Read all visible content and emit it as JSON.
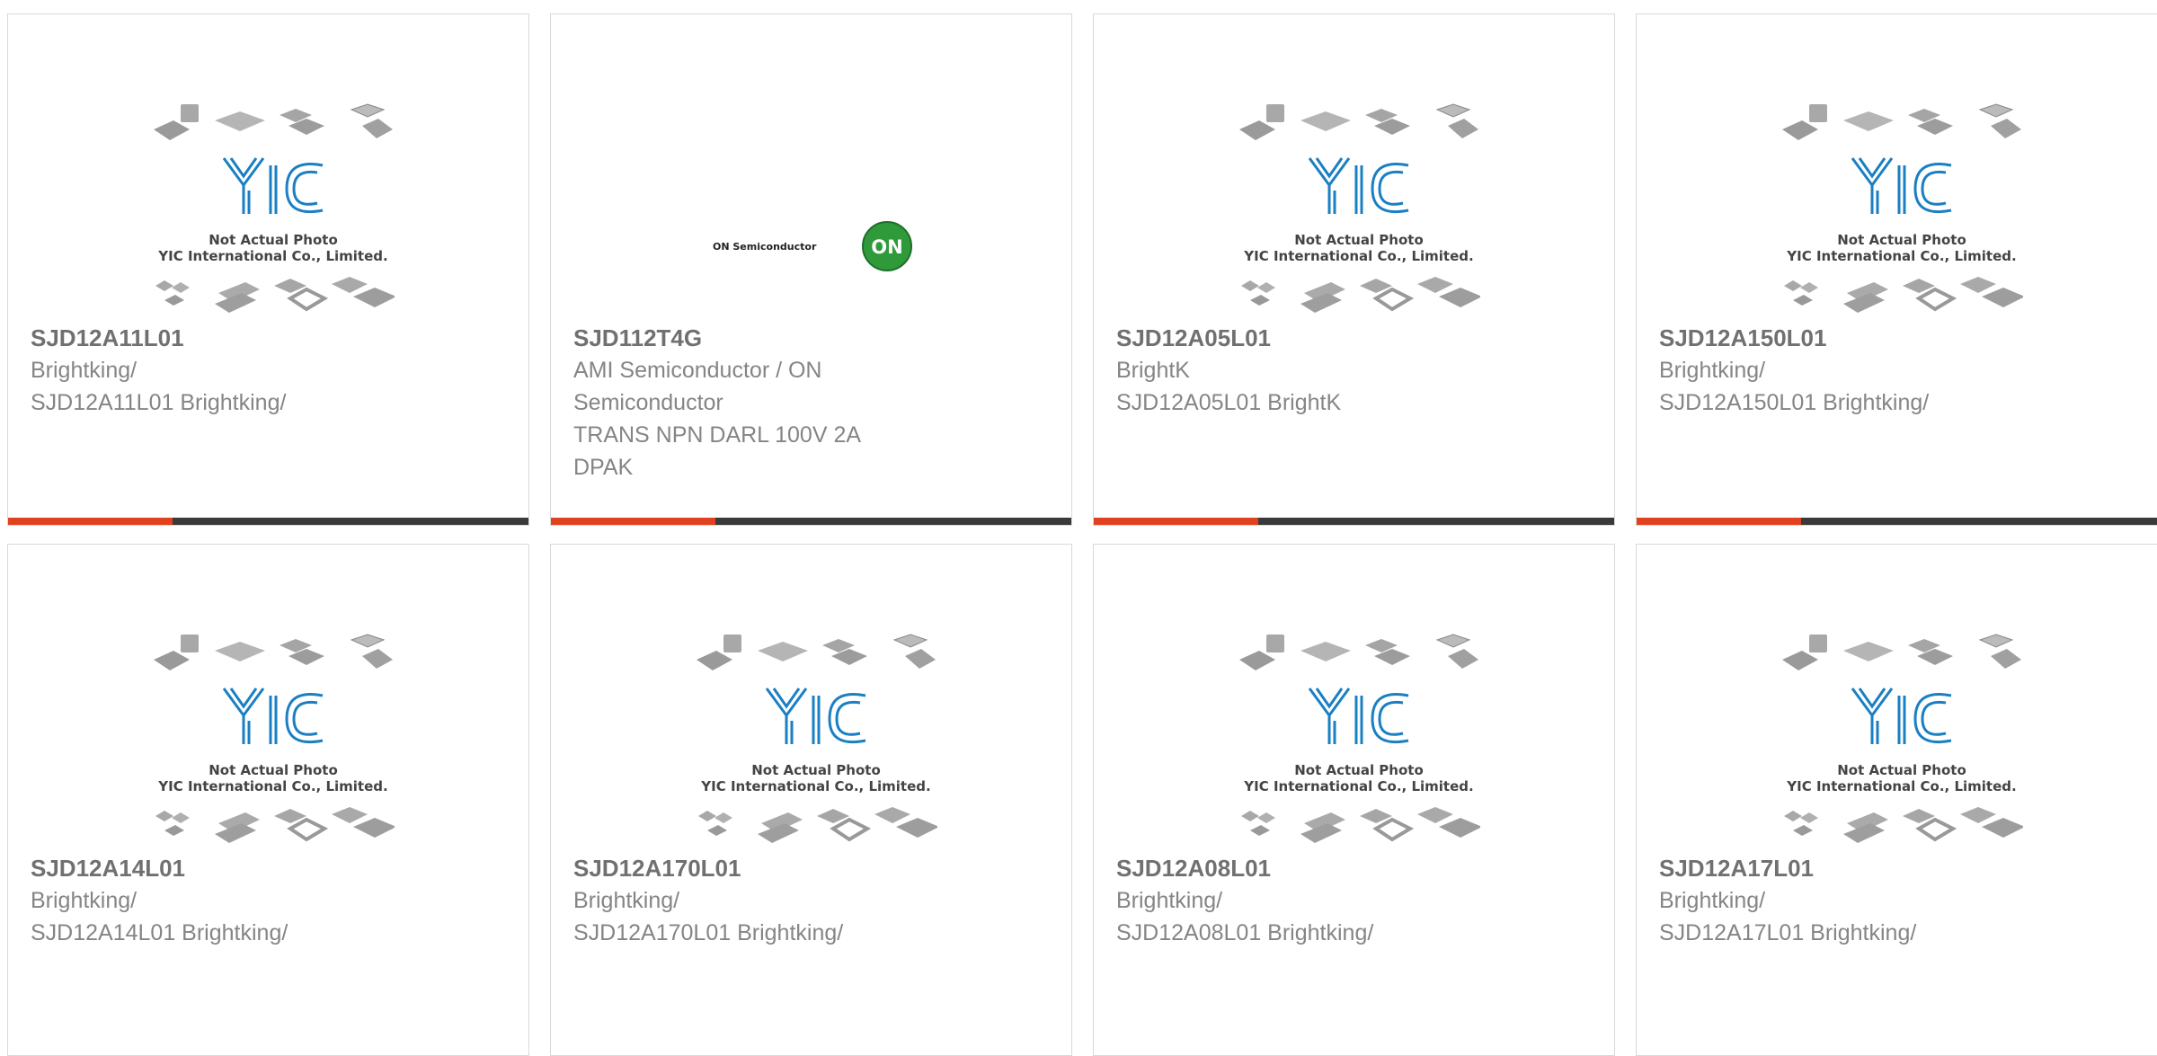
{
  "placeholder_caption": [
    "Not Actual Photo",
    "YIC International Co., Limited."
  ],
  "on_logo": {
    "text": "ON Semiconductor",
    "badge": "ON"
  },
  "colors": {
    "accent": "#e2411f",
    "bar": "#3a3a3a",
    "yic_blue": "#1a7fc3"
  },
  "products": [
    {
      "name": "SJD12A11L01",
      "lines": [
        "Brightking/",
        "SJD12A11L01 Brightking/"
      ],
      "image": "yic-placeholder"
    },
    {
      "name": "SJD112T4G",
      "lines": [
        "AMI Semiconductor / ON",
        "Semiconductor",
        "TRANS NPN DARL 100V 2A",
        "DPAK"
      ],
      "image": "on-semiconductor-logo"
    },
    {
      "name": "SJD12A05L01",
      "lines": [
        "BrightK",
        "SJD12A05L01 BrightK"
      ],
      "image": "yic-placeholder"
    },
    {
      "name": "SJD12A150L01",
      "lines": [
        "Brightking/",
        "SJD12A150L01 Brightking/"
      ],
      "image": "yic-placeholder"
    },
    {
      "name": "SJD12A14L01",
      "lines": [
        "Brightking/",
        "SJD12A14L01 Brightking/"
      ],
      "image": "yic-placeholder"
    },
    {
      "name": "SJD12A170L01",
      "lines": [
        "Brightking/",
        "SJD12A170L01 Brightking/"
      ],
      "image": "yic-placeholder"
    },
    {
      "name": "SJD12A08L01",
      "lines": [
        "Brightking/",
        "SJD12A08L01 Brightking/"
      ],
      "image": "yic-placeholder"
    },
    {
      "name": "SJD12A17L01",
      "lines": [
        "Brightking/",
        "SJD12A17L01 Brightking/"
      ],
      "image": "yic-placeholder"
    }
  ]
}
